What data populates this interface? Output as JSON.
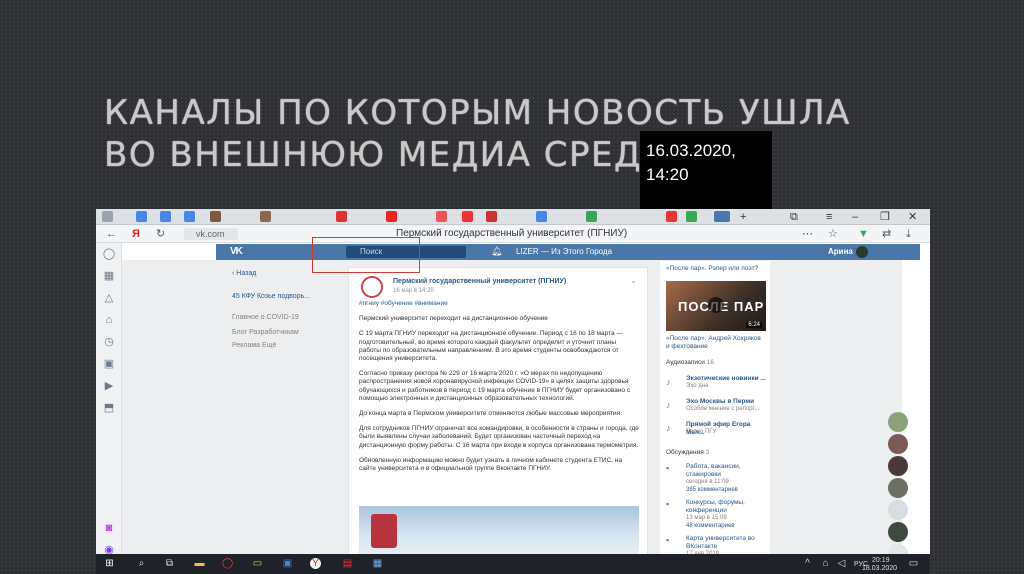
{
  "slide": {
    "title": "КАНАЛЫ ПО КОТОРЫМ НОВОСТЬ УШЛА ВО ВНЕШНЮЮ МЕДИА СРЕДУ",
    "date_line1": "16.03.2020,",
    "date_line2": "14:20"
  },
  "browser": {
    "url": "vk.com",
    "page_title": "Пермский государственный университет (ПГНИУ)",
    "yandex_label": "Я"
  },
  "vk": {
    "logo": "VK",
    "search_placeholder": "Поиск",
    "player_text": "LIZER — Из Этого Города",
    "user_name": "Арина",
    "back_label": "Назад",
    "left_menu": [
      "45  КФУ Козье подворь...",
      "Главное о COVID-19",
      "Блог   Разработчикам",
      "Реклама   Ещё"
    ],
    "post": {
      "author": "Пермский государственный университет (ПГНИУ)",
      "date": "16 мар в 14:20",
      "tags": "#пгниу #обучение #внимание",
      "paragraphs": [
        "Пермский университет переходит на дистанционное обучение",
        "С 19 марта ПГНИУ переходит на дистанционное обучение. Период с 16 по 18 марта — подготовительный, во время которого каждый факультет определит и уточнит планы работы по образовательным направлениям. В это время студенты освобождаются от посещения университета.",
        "Согласно приказу ректора № 229 от 16 марта 2020 г. «О мерах по недопущению распространения новой коронавирусной инфекции COVID-19» в целях защиты здоровья обучающихся и работников в период с 19 марта обучение в ПГНИУ будет организовано с помощью электронных и дистанционных образовательных технологий.",
        "До конца марта в Пермском университете отменяются любые массовые мероприятия.",
        "Для сотрудников ПГНИУ ограничат все командировки, в особенности в страны и города, где были выявлены случаи заболеваний. Будет организован частичный переход на дистанционную форму работы. С 16 марта при входе в корпуса организована термометрия.",
        "Обновленную информацию можно будет узнать в личном кабинете студента ЕТИС, на сайте университета и в официальной группе Вконтакте ПГНИУ."
      ]
    },
    "right": {
      "video_caption_top": "«После пар». Рэпер или поэт?",
      "video_title": "ПОСЛЕ ПАР",
      "video_duration": "6:24",
      "video_caption": "«После пар». Андрей Хохряков и фехтование",
      "audio_header": "Аудиозаписи",
      "audio_count": "16",
      "audio": [
        {
          "title": "Экзотические новинки ...",
          "sub": "Эхо дна"
        },
        {
          "title": "Эхо Москвы в Перми",
          "sub": "Особое мнение с репорт..."
        },
        {
          "title": "Прямой эфир Егора Мел...",
          "sub": "Радио ПГУ"
        }
      ],
      "discuss_header": "Обсуждения",
      "discuss_count": "3",
      "discussions": [
        {
          "title": "Работа, вакансии, стажировки",
          "date": "сегодня в 11:09",
          "comments": "385 комментариев"
        },
        {
          "title": "Конкурсы, форумы, конференции",
          "date": "13 мар в 15:09",
          "comments": "48 комментариев"
        },
        {
          "title": "Карта университета во ВКонтакте",
          "date": "17 янв 2019",
          "comments": "13 комментариев"
        }
      ]
    }
  },
  "taskbar": {
    "lang": "РУС",
    "time": "20:19",
    "date": "18.03.2020"
  },
  "colors": {
    "vk_blue": "#4a76a8",
    "highlight_red": "#d23a3a",
    "slide_bg": "#2f3033"
  }
}
